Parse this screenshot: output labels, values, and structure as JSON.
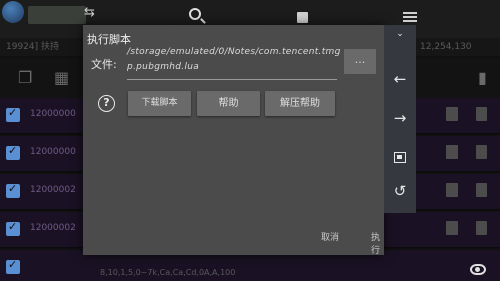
{
  "background": {
    "status_text": "19924] 扶持",
    "status_numbers": "12,254,130",
    "rows": [
      {
        "value": "12000000"
      },
      {
        "value": "12000000"
      },
      {
        "value": "12000002"
      },
      {
        "value": "12000002"
      }
    ],
    "bottom_text": "8,10,1,5,0~7k,Ca,Ca,Cd,0A,A,100"
  },
  "dialog": {
    "title": "执行脚本",
    "file_label": "文件:",
    "file_path": "/storage/emulated/0/Notes/com.tencent.tmgp.pubgmhd.lua",
    "browse_label": "...",
    "help_icon": "?",
    "download_button": "下载脚本",
    "help_button": "帮助",
    "extract_help_button": "解压帮助",
    "cancel": "取消",
    "execute": "执行"
  },
  "icons": {
    "swap": "swap-icon",
    "search": "search-icon",
    "save": "save-icon",
    "menu": "menu-icon",
    "collapse": "chevron-down-icon",
    "left": "arrow-left-icon",
    "right": "arrow-right-icon",
    "fit": "fit-screen-icon",
    "history": "history-icon",
    "visibility": "eye-icon"
  },
  "colors": {
    "dialog_bg": "#4b4b4b",
    "button_bg": "#6a6a6a",
    "side_panel": "#35393f",
    "checkbox": "#5b8fd3"
  }
}
